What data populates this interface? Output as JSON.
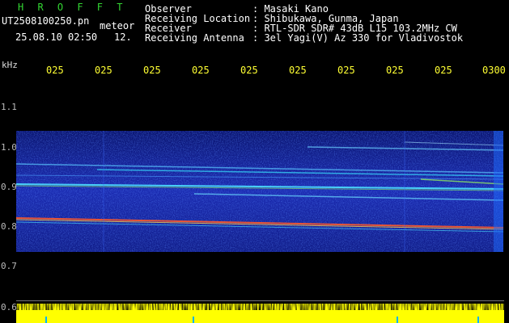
{
  "header": {
    "app_title": "H R O F F T",
    "file_name": "UT2508100250.pn",
    "mode_label": "meteor",
    "date_time": "25.08.10 02:50",
    "count_value": "12.",
    "fields": [
      {
        "label": "Observer",
        "value": ": Masaki Kano"
      },
      {
        "label": "Receiving Location",
        "value": ": Shibukawa, Gunma, Japan"
      },
      {
        "label": "Receiver",
        "value": ": RTL-SDR SDR# 43dB L15 103.2MHz CW"
      },
      {
        "label": "Receiving Antenna",
        "value": ": 3el Yagi(V) Az 330 for Vladivostok"
      }
    ]
  },
  "axis": {
    "unit_label": "kHz",
    "time_ticks": [
      "025",
      "025",
      "025",
      "025",
      "025",
      "025",
      "025",
      "025",
      "025",
      "0300"
    ],
    "freq_ticks": [
      "1.1",
      "1.0",
      "0.9",
      "0.8",
      "0.7",
      "0.6"
    ]
  },
  "colors": {
    "title_green": "#33d633",
    "axis_yellow": "#ffff33",
    "background": "#000000",
    "noise_blue": "#1a2ab0"
  }
}
